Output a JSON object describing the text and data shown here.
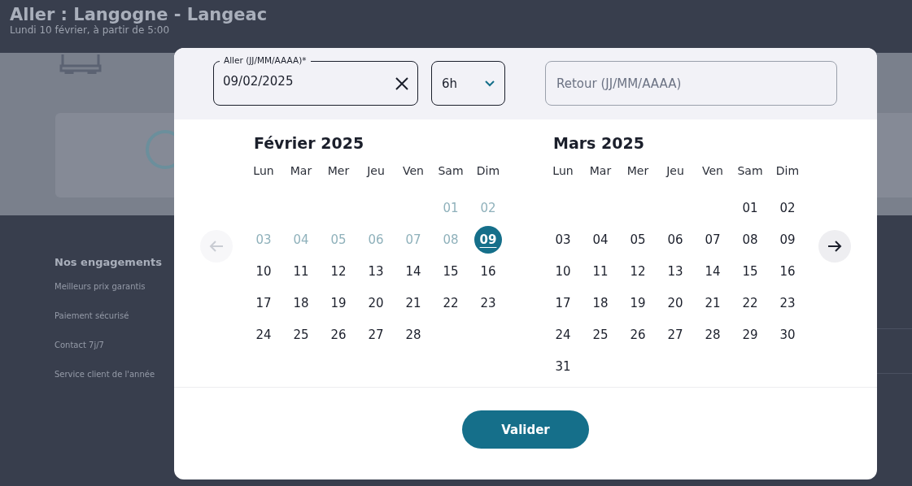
{
  "page": {
    "title": "Aller : Langogne - Langeac",
    "subtitle": "Lundi 10 février, à partir de 5:00",
    "footer": {
      "heading": "Nos engagements",
      "links": [
        "Meilleurs prix garantis",
        "Paiement sécurisé",
        "Contact 7j/7",
        "Service client de l'année"
      ]
    }
  },
  "date_picker": {
    "outbound_field": {
      "label": "Aller (JJ/MM/AAAA)*",
      "value": "09/02/2025"
    },
    "time_select": {
      "value": "6h"
    },
    "return_field": {
      "placeholder": "Retour (JJ/MM/AAAA)"
    },
    "prev_disabled": true,
    "months": [
      {
        "title": "Février 2025",
        "weekdays": [
          "Lun",
          "Mar",
          "Mer",
          "Jeu",
          "Ven",
          "Sam",
          "Dim"
        ],
        "days": [
          {
            "kind": "empty"
          },
          {
            "kind": "empty"
          },
          {
            "kind": "empty"
          },
          {
            "kind": "empty"
          },
          {
            "kind": "empty"
          },
          {
            "kind": "day",
            "label": "01",
            "disabled": true,
            "selected": false
          },
          {
            "kind": "day",
            "label": "02",
            "disabled": true,
            "selected": false
          },
          {
            "kind": "day",
            "label": "03",
            "disabled": true,
            "selected": false
          },
          {
            "kind": "day",
            "label": "04",
            "disabled": true,
            "selected": false
          },
          {
            "kind": "day",
            "label": "05",
            "disabled": true,
            "selected": false
          },
          {
            "kind": "day",
            "label": "06",
            "disabled": true,
            "selected": false
          },
          {
            "kind": "day",
            "label": "07",
            "disabled": true,
            "selected": false
          },
          {
            "kind": "day",
            "label": "08",
            "disabled": true,
            "selected": false
          },
          {
            "kind": "day",
            "label": "09",
            "disabled": false,
            "selected": true
          },
          {
            "kind": "day",
            "label": "10",
            "disabled": false,
            "selected": false
          },
          {
            "kind": "day",
            "label": "11",
            "disabled": false,
            "selected": false
          },
          {
            "kind": "day",
            "label": "12",
            "disabled": false,
            "selected": false
          },
          {
            "kind": "day",
            "label": "13",
            "disabled": false,
            "selected": false
          },
          {
            "kind": "day",
            "label": "14",
            "disabled": false,
            "selected": false
          },
          {
            "kind": "day",
            "label": "15",
            "disabled": false,
            "selected": false
          },
          {
            "kind": "day",
            "label": "16",
            "disabled": false,
            "selected": false
          },
          {
            "kind": "day",
            "label": "17",
            "disabled": false,
            "selected": false
          },
          {
            "kind": "day",
            "label": "18",
            "disabled": false,
            "selected": false
          },
          {
            "kind": "day",
            "label": "19",
            "disabled": false,
            "selected": false
          },
          {
            "kind": "day",
            "label": "20",
            "disabled": false,
            "selected": false
          },
          {
            "kind": "day",
            "label": "21",
            "disabled": false,
            "selected": false
          },
          {
            "kind": "day",
            "label": "22",
            "disabled": false,
            "selected": false
          },
          {
            "kind": "day",
            "label": "23",
            "disabled": false,
            "selected": false
          },
          {
            "kind": "day",
            "label": "24",
            "disabled": false,
            "selected": false
          },
          {
            "kind": "day",
            "label": "25",
            "disabled": false,
            "selected": false
          },
          {
            "kind": "day",
            "label": "26",
            "disabled": false,
            "selected": false
          },
          {
            "kind": "day",
            "label": "27",
            "disabled": false,
            "selected": false
          },
          {
            "kind": "day",
            "label": "28",
            "disabled": false,
            "selected": false
          }
        ]
      },
      {
        "title": "Mars 2025",
        "weekdays": [
          "Lun",
          "Mar",
          "Mer",
          "Jeu",
          "Ven",
          "Sam",
          "Dim"
        ],
        "days": [
          {
            "kind": "empty"
          },
          {
            "kind": "empty"
          },
          {
            "kind": "empty"
          },
          {
            "kind": "empty"
          },
          {
            "kind": "empty"
          },
          {
            "kind": "day",
            "label": "01",
            "disabled": false,
            "selected": false
          },
          {
            "kind": "day",
            "label": "02",
            "disabled": false,
            "selected": false
          },
          {
            "kind": "day",
            "label": "03",
            "disabled": false,
            "selected": false
          },
          {
            "kind": "day",
            "label": "04",
            "disabled": false,
            "selected": false
          },
          {
            "kind": "day",
            "label": "05",
            "disabled": false,
            "selected": false
          },
          {
            "kind": "day",
            "label": "06",
            "disabled": false,
            "selected": false
          },
          {
            "kind": "day",
            "label": "07",
            "disabled": false,
            "selected": false
          },
          {
            "kind": "day",
            "label": "08",
            "disabled": false,
            "selected": false
          },
          {
            "kind": "day",
            "label": "09",
            "disabled": false,
            "selected": false
          },
          {
            "kind": "day",
            "label": "10",
            "disabled": false,
            "selected": false
          },
          {
            "kind": "day",
            "label": "11",
            "disabled": false,
            "selected": false
          },
          {
            "kind": "day",
            "label": "12",
            "disabled": false,
            "selected": false
          },
          {
            "kind": "day",
            "label": "13",
            "disabled": false,
            "selected": false
          },
          {
            "kind": "day",
            "label": "14",
            "disabled": false,
            "selected": false
          },
          {
            "kind": "day",
            "label": "15",
            "disabled": false,
            "selected": false
          },
          {
            "kind": "day",
            "label": "16",
            "disabled": false,
            "selected": false
          },
          {
            "kind": "day",
            "label": "17",
            "disabled": false,
            "selected": false
          },
          {
            "kind": "day",
            "label": "18",
            "disabled": false,
            "selected": false
          },
          {
            "kind": "day",
            "label": "19",
            "disabled": false,
            "selected": false
          },
          {
            "kind": "day",
            "label": "20",
            "disabled": false,
            "selected": false
          },
          {
            "kind": "day",
            "label": "21",
            "disabled": false,
            "selected": false
          },
          {
            "kind": "day",
            "label": "22",
            "disabled": false,
            "selected": false
          },
          {
            "kind": "day",
            "label": "23",
            "disabled": false,
            "selected": false
          },
          {
            "kind": "day",
            "label": "24",
            "disabled": false,
            "selected": false
          },
          {
            "kind": "day",
            "label": "25",
            "disabled": false,
            "selected": false
          },
          {
            "kind": "day",
            "label": "26",
            "disabled": false,
            "selected": false
          },
          {
            "kind": "day",
            "label": "27",
            "disabled": false,
            "selected": false
          },
          {
            "kind": "day",
            "label": "28",
            "disabled": false,
            "selected": false
          },
          {
            "kind": "day",
            "label": "29",
            "disabled": false,
            "selected": false
          },
          {
            "kind": "day",
            "label": "30",
            "disabled": false,
            "selected": false
          },
          {
            "kind": "day",
            "label": "31",
            "disabled": false,
            "selected": false
          }
        ]
      }
    ],
    "confirm_button": "Valider"
  }
}
